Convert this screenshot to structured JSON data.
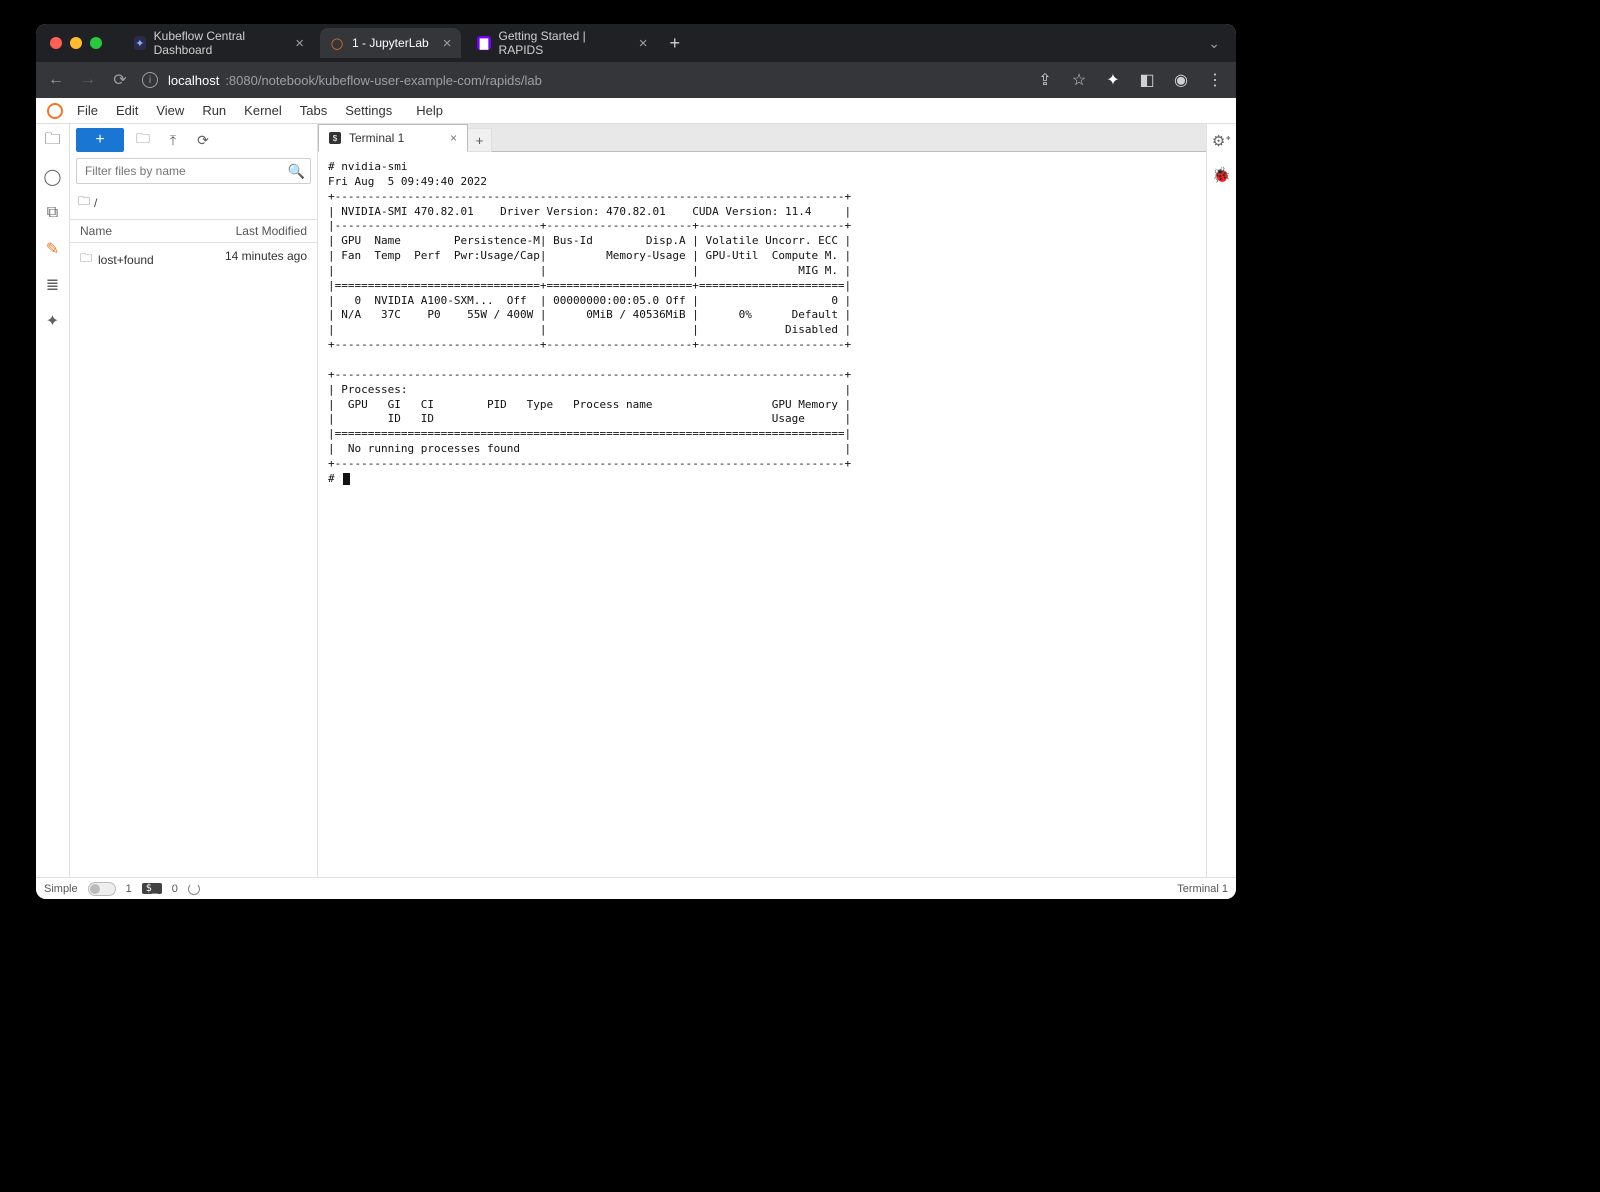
{
  "chrome": {
    "tabs": [
      {
        "title": "Kubeflow Central Dashboard",
        "active": false
      },
      {
        "title": "1 - JupyterLab",
        "active": true
      },
      {
        "title": "Getting Started | RAPIDS",
        "active": false
      }
    ],
    "url_host": "localhost",
    "url_path": ":8080/notebook/kubeflow-user-example-com/rapids/lab"
  },
  "menu": {
    "items": [
      "File",
      "Edit",
      "View",
      "Run",
      "Kernel",
      "Tabs",
      "Settings",
      "Help"
    ]
  },
  "toolbar": {
    "new_label": "+",
    "filter_placeholder": "Filter files by name"
  },
  "breadcrumb": {
    "root": "/"
  },
  "files": {
    "col_name": "Name",
    "col_modified": "Last Modified",
    "rows": [
      {
        "name": "lost+found",
        "modified": "14 minutes ago"
      }
    ]
  },
  "doc_tab": {
    "title": "Terminal 1"
  },
  "terminal": {
    "content": "# nvidia-smi\nFri Aug  5 09:49:40 2022\n+-----------------------------------------------------------------------------+\n| NVIDIA-SMI 470.82.01    Driver Version: 470.82.01    CUDA Version: 11.4     |\n|-------------------------------+----------------------+----------------------+\n| GPU  Name        Persistence-M| Bus-Id        Disp.A | Volatile Uncorr. ECC |\n| Fan  Temp  Perf  Pwr:Usage/Cap|         Memory-Usage | GPU-Util  Compute M. |\n|                               |                      |               MIG M. |\n|===============================+======================+======================|\n|   0  NVIDIA A100-SXM...  Off  | 00000000:00:05.0 Off |                    0 |\n| N/A   37C    P0    55W / 400W |      0MiB / 40536MiB |      0%      Default |\n|                               |                      |             Disabled |\n+-------------------------------+----------------------+----------------------+\n\n+-----------------------------------------------------------------------------+\n| Processes:                                                                  |\n|  GPU   GI   CI        PID   Type   Process name                  GPU Memory |\n|        ID   ID                                                   Usage      |\n|=============================================================================|\n|  No running processes found                                                 |\n+-----------------------------------------------------------------------------+\n# "
  },
  "status": {
    "simple": "Simple",
    "count": "1",
    "kernel_badge": "$_",
    "zero": "0",
    "mode": "Terminal 1"
  }
}
